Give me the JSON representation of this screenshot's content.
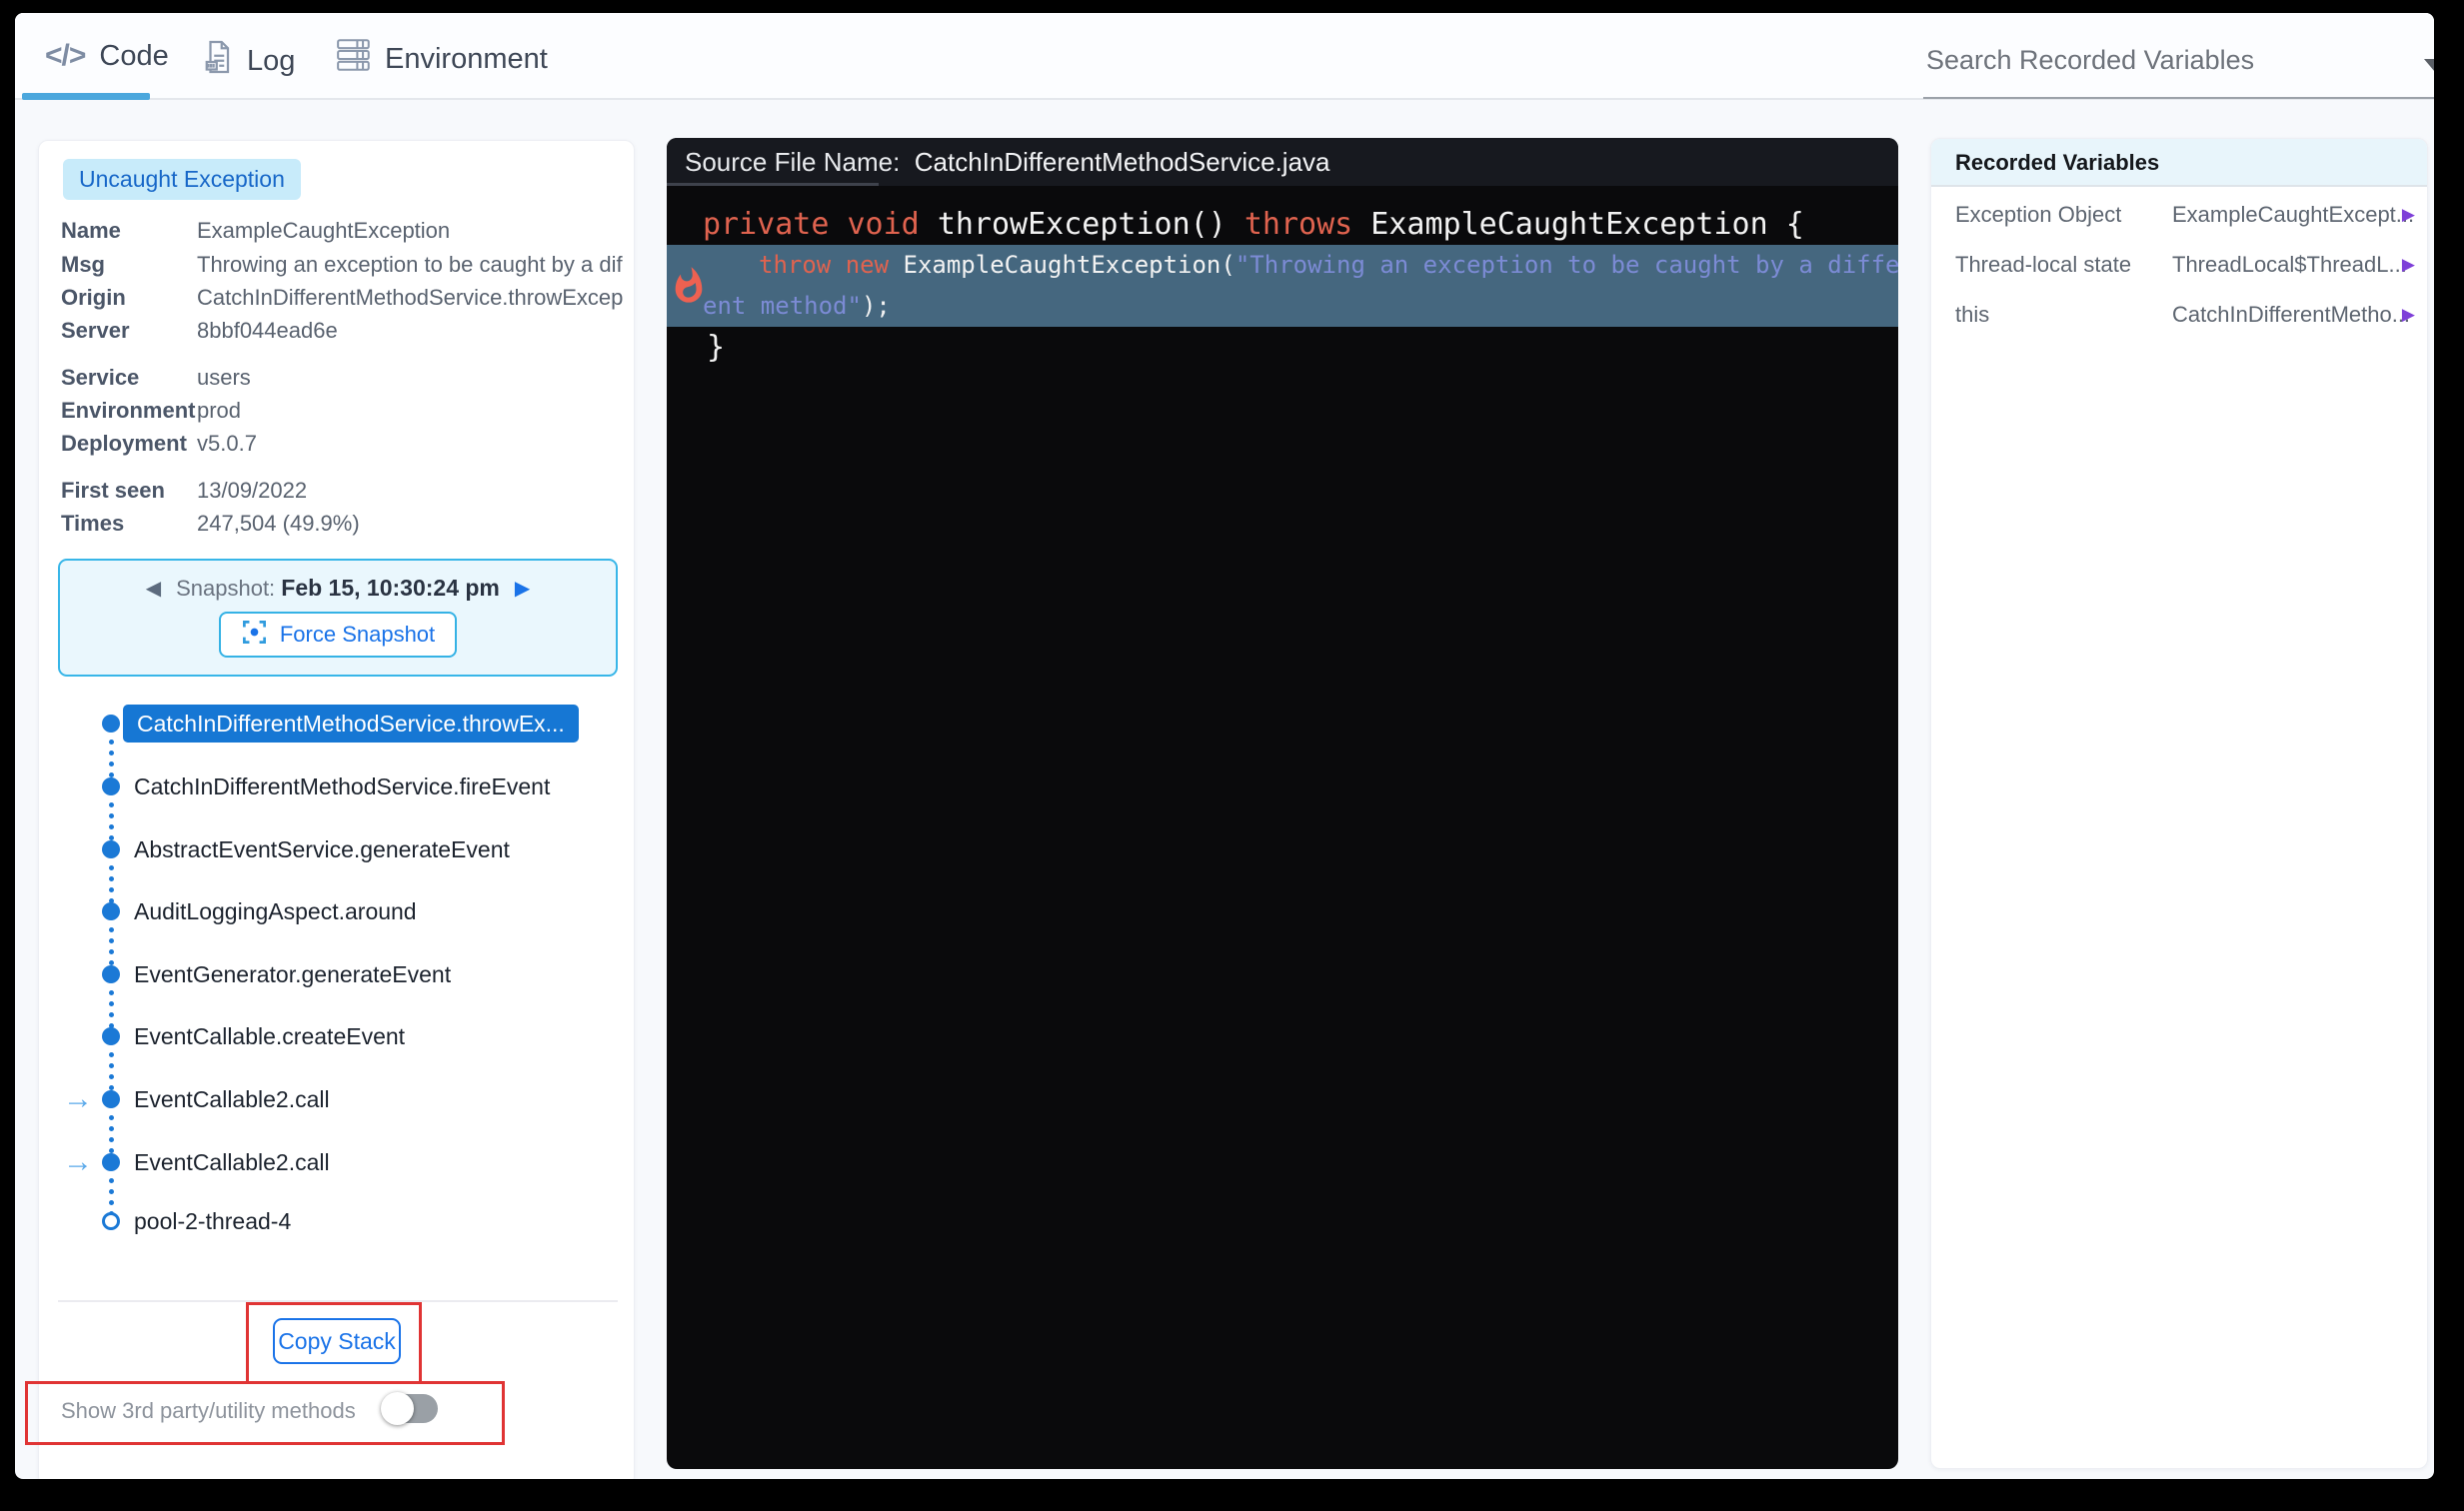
{
  "tabs": {
    "code": "Code",
    "log": "Log",
    "environment": "Environment"
  },
  "search": {
    "label": "Search Recorded Variables"
  },
  "exception": {
    "badge": "Uncaught Exception",
    "rows": [
      {
        "label": "Name",
        "value": "ExampleCaughtException"
      },
      {
        "label": "Msg",
        "value": "Throwing an exception to be caught by a dif"
      },
      {
        "label": "Origin",
        "value": "CatchInDifferentMethodService.throwExcep"
      },
      {
        "label": "Server",
        "value": "8bbf044ead6e"
      },
      {
        "label": "Service",
        "value": "users"
      },
      {
        "label": "Environment",
        "value": "prod"
      },
      {
        "label": "Deployment",
        "value": "v5.0.7"
      },
      {
        "label": "First seen",
        "value": "13/09/2022"
      },
      {
        "label": "Times",
        "value": "247,504 (49.9%)"
      }
    ]
  },
  "snapshot": {
    "prev": "◀",
    "prefix": "Snapshot: ",
    "date": "Feb 15, 10:30:24 pm",
    "next": "▶",
    "force_label": "Force Snapshot"
  },
  "stack": {
    "items": [
      {
        "label": "CatchInDifferentMethodService.throwEx..."
      },
      {
        "label": "CatchInDifferentMethodService.fireEvent"
      },
      {
        "label": "AbstractEventService.generateEvent"
      },
      {
        "label": "AuditLoggingAspect.around"
      },
      {
        "label": "EventGenerator.generateEvent"
      },
      {
        "label": "EventCallable.createEvent"
      },
      {
        "label": "EventCallable2.call"
      },
      {
        "label": "EventCallable2.call"
      },
      {
        "label": "pool-2-thread-4"
      }
    ],
    "arrow_glyph": "→",
    "copy_label": "Copy Stack",
    "toggle_label": "Show 3rd party/utility methods"
  },
  "code": {
    "header_label": "Source File Name:",
    "file": "CatchInDifferentMethodService.java",
    "line1": {
      "s0": "private void ",
      "s1": "throwException() ",
      "s2": "throws",
      "s3": " ExampleCaughtException {"
    },
    "line2a": {
      "s0": "throw new ",
      "s1": "ExampleCaughtException(",
      "s2": "\"Throwing an exception to be caught by a differ"
    },
    "line2b": {
      "s0": "ent method\"",
      "s1": ");"
    },
    "line3": "}"
  },
  "variables": {
    "title": "Recorded Variables",
    "rows": [
      {
        "label": "Exception Object",
        "value": "ExampleCaughtExcept...",
        "arrow": "▶"
      },
      {
        "label": "Thread-local state",
        "value": "ThreadLocal$ThreadL...",
        "arrow": "▶"
      },
      {
        "label": "this",
        "value": "CatchInDifferentMetho...",
        "arrow": "▶"
      }
    ]
  },
  "colors": {
    "accent_blue": "#1a73e8",
    "tab_underline": "#4ba7dd",
    "badge_bg": "#c8ebfa",
    "badge_text": "#1767c8",
    "selected_stack_bg": "#1677d4",
    "stack_dot": "#1b79d6",
    "code_highlight_bg": "#45677f",
    "code_keyword": "#e0634f",
    "code_string": "#7c8bd5",
    "flame": "#ee6151",
    "snapshot_border": "#38b6e8",
    "variable_arrow": "#7e3fd8",
    "annotation_red": "#e03434"
  }
}
